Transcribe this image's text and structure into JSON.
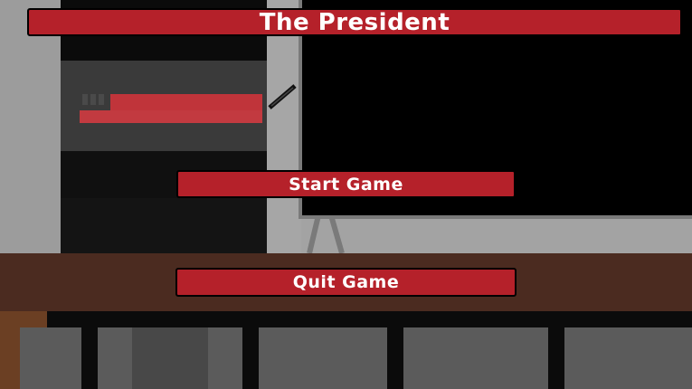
{
  "title": "The President",
  "menu": {
    "start_label": "Start Game",
    "quit_label": "Quit Game"
  },
  "colors": {
    "button_red": "#b5212a",
    "button_text": "#ffffff",
    "desk_brown": "#4b2b20",
    "wall_gray": "#9c9c9c"
  }
}
